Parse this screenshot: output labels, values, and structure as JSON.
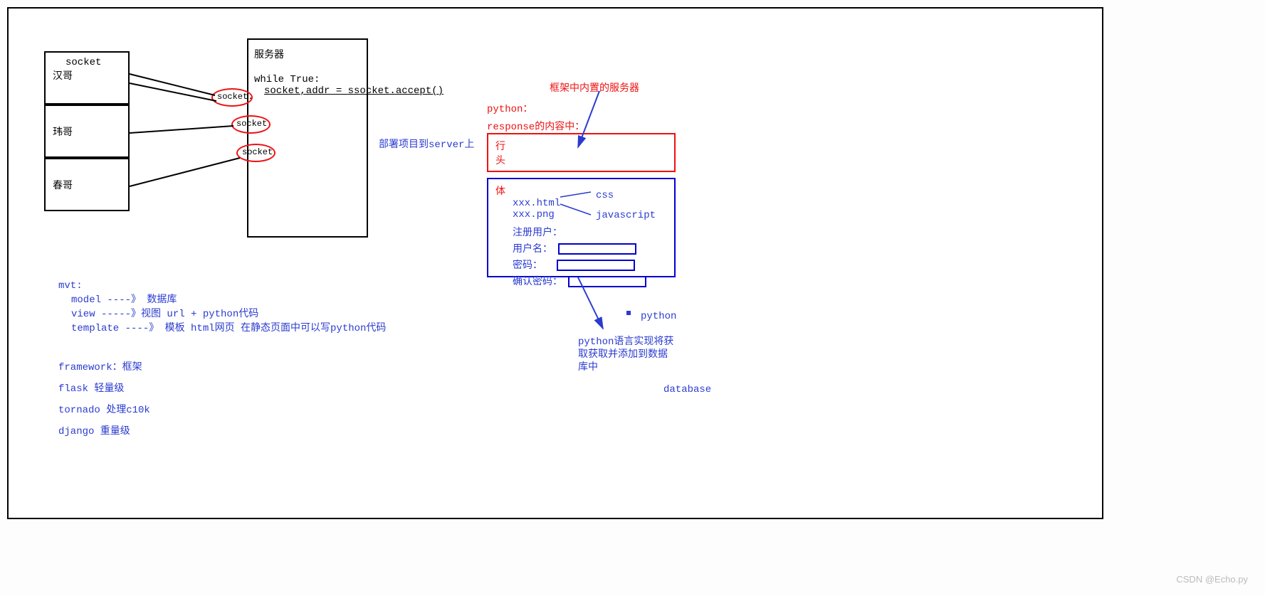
{
  "clients": {
    "socket_label": "socket",
    "c1": "汉哥",
    "c2": "玮哥",
    "c3": "春哥"
  },
  "sockets": {
    "s1": "socket.",
    "s2": "socket",
    "s3": "socket"
  },
  "server": {
    "title": "服务器",
    "line1": "while True:",
    "line2": "socket,addr = ssocket.accept()"
  },
  "deploy": "部署项目到server上",
  "mvt": {
    "header": "mvt:",
    "model": "model   ----》 数据库",
    "view": "view  -----》视图   url + python代码",
    "template": "template ----》  模板  html网页  在静态页面中可以写python代码"
  },
  "frameworks": {
    "header": "framework：框架",
    "flask": "flask     轻量级",
    "tornado": "tornado   处理c10k",
    "django": "django    重量级"
  },
  "right": {
    "top_label": "框架中内置的服务器",
    "python": "python：",
    "response": "response的内容中：",
    "line": "行",
    "head": "头",
    "body": "体",
    "html": "xxx.html",
    "png": "xxx.png",
    "css": "css",
    "js": "javascript",
    "register": "注册用户：",
    "username": "用户名：",
    "password": "密码：",
    "confirm": "确认密码：",
    "python_note_dot": "python",
    "python_impl_l1": "python语言实现将获",
    "python_impl_l2": "取获取并添加到数据",
    "python_impl_l3": "库中",
    "database": "database"
  },
  "watermark": "CSDN @Echo.py"
}
